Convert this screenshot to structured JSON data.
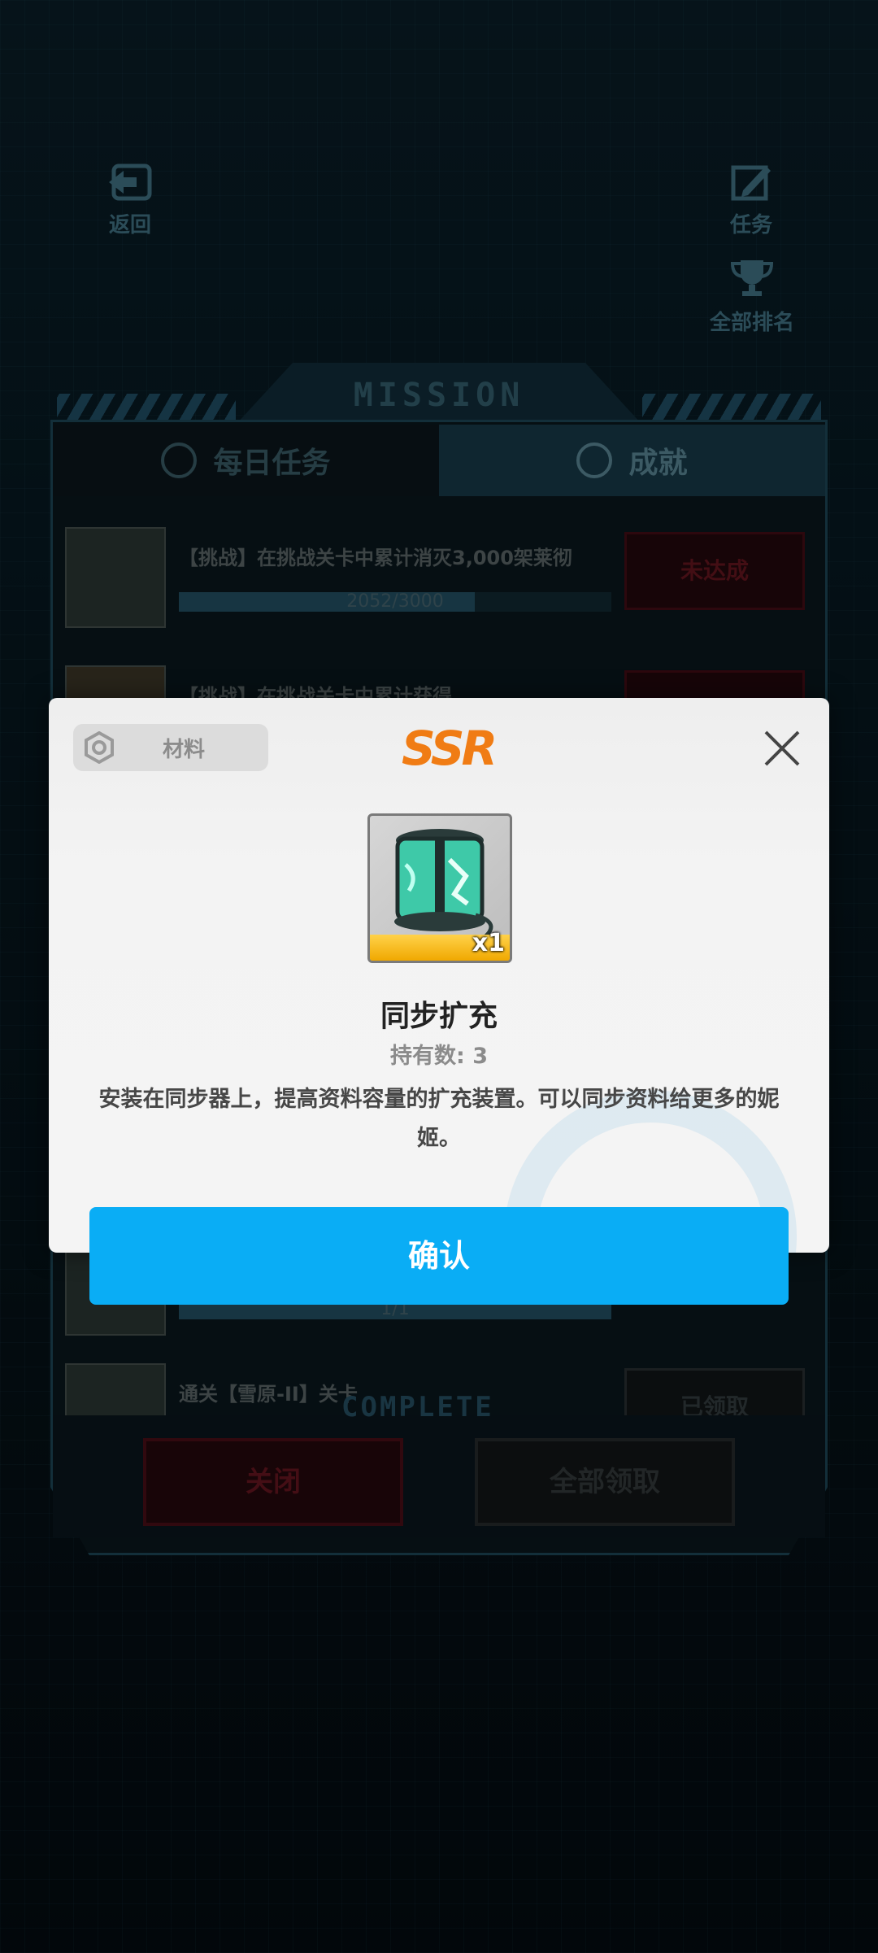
{
  "top": {
    "back_label": "返回",
    "mission_label": "任务",
    "ranking_label": "全部排名"
  },
  "panel": {
    "header": "MISSION",
    "tabs": [
      {
        "label": "每日任务",
        "icon": "biohazard-icon"
      },
      {
        "label": "成就",
        "icon": "star-circle-icon"
      }
    ],
    "rows": [
      {
        "title": "【挑战】在挑战关卡中累计消灭3,000架莱彻",
        "progress_text": "2052/3000",
        "progress": 0.684,
        "status": "未达成"
      },
      {
        "title": "【挑战】在挑战关卡中累计获得...",
        "progress_text": "",
        "progress": 0,
        "status": ""
      },
      {
        "title": "",
        "progress_text": "1/1",
        "progress": 1.0,
        "status": ""
      },
      {
        "title": "通关【雪原-II】关卡",
        "progress_text": "",
        "progress": 1.0,
        "status": "已领取"
      }
    ],
    "complete_label": "COMPLETE",
    "close_label": "关闭",
    "claim_all_label": "全部领取"
  },
  "dialog": {
    "category": "材料",
    "rarity": "SSR",
    "item_name": "同步扩充",
    "owned": "持有数: 3",
    "quantity": "x1",
    "description": "安装在同步器上，提高资料容量的扩充装置。可以同步资料给更多的妮姬。",
    "confirm_label": "确认",
    "colors": {
      "rarity": "#f07c14",
      "confirm": "#0aadf5"
    }
  }
}
